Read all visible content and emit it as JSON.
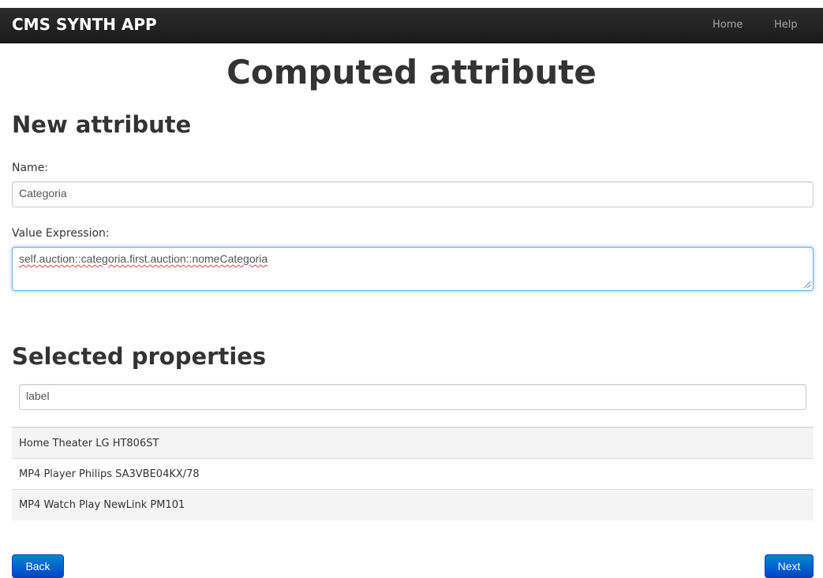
{
  "navbar": {
    "brand": "CMS SYNTH APP",
    "links": [
      {
        "label": "Home"
      },
      {
        "label": "Help"
      }
    ]
  },
  "page_title": "Computed attribute",
  "new_attribute": {
    "title": "New attribute",
    "name_label": "Name:",
    "name_value": "Categoria",
    "expression_label": "Value Expression:",
    "expression_value": "self.auction::categoria.first.auction::nomeCategoria"
  },
  "selected_properties": {
    "title": "Selected properties",
    "filter_value": "label",
    "items": [
      {
        "label": "Home Theater LG HT806ST"
      },
      {
        "label": "MP4 Player Philips SA3VBE04KX/78"
      },
      {
        "label": "MP4 Watch Play NewLink PM101"
      }
    ]
  },
  "buttons": {
    "back": "Back",
    "next": "Next"
  },
  "colors": {
    "navbar": "#1b1b1b",
    "primary_button": "#0055cc",
    "focus_border": "#66afe9"
  }
}
